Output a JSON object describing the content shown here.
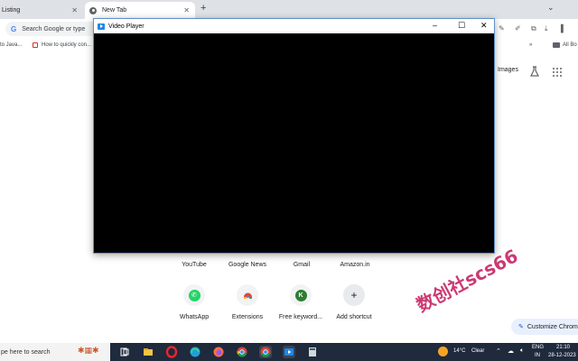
{
  "browser": {
    "tabs": [
      {
        "label": "Listing",
        "active": false
      },
      {
        "label": "New Tab",
        "active": true
      }
    ],
    "new_tab_symbol": "+",
    "close_symbol": "✕",
    "omnibox_placeholder": "Search Google or type",
    "bookmarks": [
      {
        "label": "to Java..."
      },
      {
        "label": "How to quickly con..."
      }
    ],
    "bookmarks_more": "»",
    "all_bookmarks": "All Bo"
  },
  "ntp": {
    "images_link": "Images",
    "shortcuts_row1": [
      "YouTube",
      "Google News",
      "Gmail",
      "Amazon.in"
    ],
    "shortcuts_row2": [
      {
        "label": "WhatsApp",
        "icon": "whatsapp-icon",
        "color": "#25d366"
      },
      {
        "label": "Extensions",
        "icon": "chrome-web-store-icon",
        "color": "#ea4335"
      },
      {
        "label": "Free keyword...",
        "icon": "k-letter-icon",
        "color": "#2e7d32",
        "letter": "K"
      },
      {
        "label": "Add shortcut",
        "icon": "plus-icon",
        "color": "#1a73e8",
        "letter": "+"
      }
    ],
    "customize_label": "Customize Chrom"
  },
  "watermark": "数创社scs66",
  "video_player": {
    "title": "Video Player",
    "minimize": "–",
    "maximize": "☐",
    "close": "✕",
    "background": "#000000"
  },
  "taskbar": {
    "search_placeholder": "pe here to search",
    "weather_temp": "14°C",
    "weather_desc": "Clear",
    "lang_primary": "ENG",
    "lang_secondary": "IN",
    "time": "21:10",
    "date": "28-12-2023",
    "apps": [
      "task-view-icon",
      "file-explorer-icon",
      "opera-icon",
      "edge-icon",
      "firefox-icon",
      "chrome-icon",
      "chrome-alt-icon",
      "video-player-icon",
      "calculator-icon"
    ]
  },
  "colors": {
    "tabstrip": "#dee1e6",
    "taskbar": "#1f2a3c",
    "accent": "#1a73e8"
  }
}
